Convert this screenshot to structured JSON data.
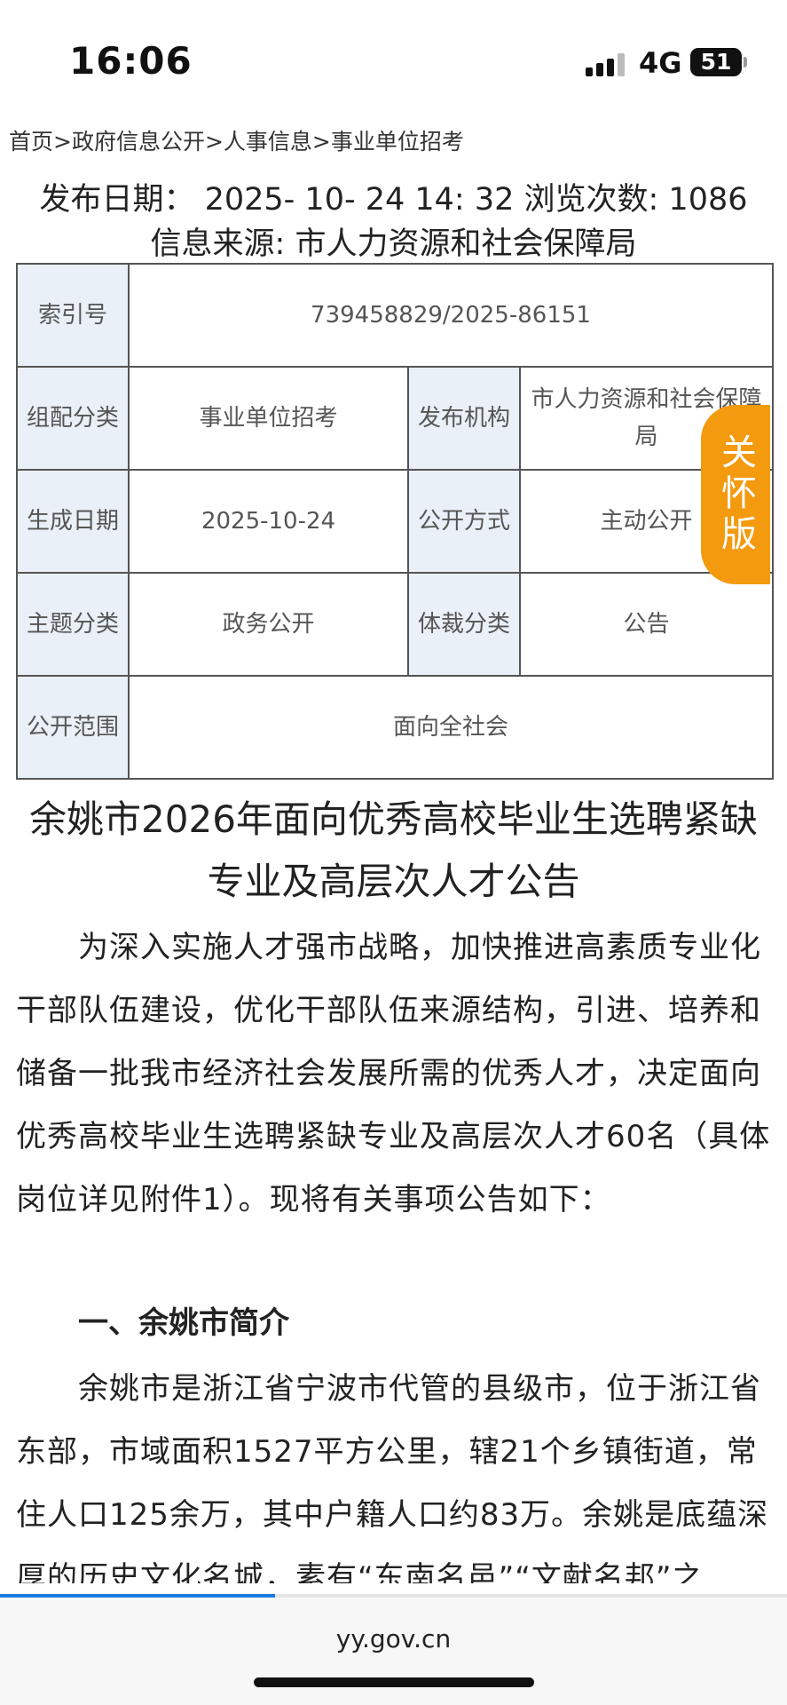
{
  "status": {
    "time": "16:06",
    "network": "4G",
    "battery": "51"
  },
  "breadcrumb": "首页>政府信息公开>人事信息>事业单位招考",
  "meta": {
    "line1": "发布日期： 2025- 10- 24 14: 32 浏览次数: 1086",
    "line2": "信息来源: 市人力资源和社会保障局"
  },
  "info_table": {
    "index_label": "索引号",
    "index_value": "739458829/2025-86151",
    "category_label": "组配分类",
    "category_value": "事业单位招考",
    "publisher_label": "发布机构",
    "publisher_value": "市人力资源和社会保障局",
    "date_label": "生成日期",
    "date_value": "2025-10-24",
    "open_method_label": "公开方式",
    "open_method_value": "主动公开",
    "topic_label": "主题分类",
    "topic_value": "政务公开",
    "genre_label": "体裁分类",
    "genre_value": "公告",
    "scope_label": "公开范围",
    "scope_value": "面向全社会"
  },
  "care_button": {
    "label": "关怀版"
  },
  "article": {
    "title": "余姚市2026年面向优秀高校毕业生选聘紧缺专业及高层次人才公告",
    "para1": "为深入实施人才强市战略，加快推进高素质专业化干部队伍建设，优化干部队伍来源结构，引进、培养和储备一批我市经济社会发展所需的优秀人才，决定面向优秀高校毕业生选聘紧缺专业及高层次人才60名（具体岗位详见附件1）。现将有关事项公告如下：",
    "section1": "一、余姚市简介",
    "para2": "余姚市是浙江省宁波市代管的县级市，位于浙江省东部，市域面积1527平方公里，辖21个乡镇街道，常住人口125余万，其中户籍人口约83万。余姚是底蕴深厚的历史文化名城，素有“东南名邑”“文献名邦”之"
  },
  "browser": {
    "url": "yy.gov.cn",
    "load_progress": 0.35
  }
}
